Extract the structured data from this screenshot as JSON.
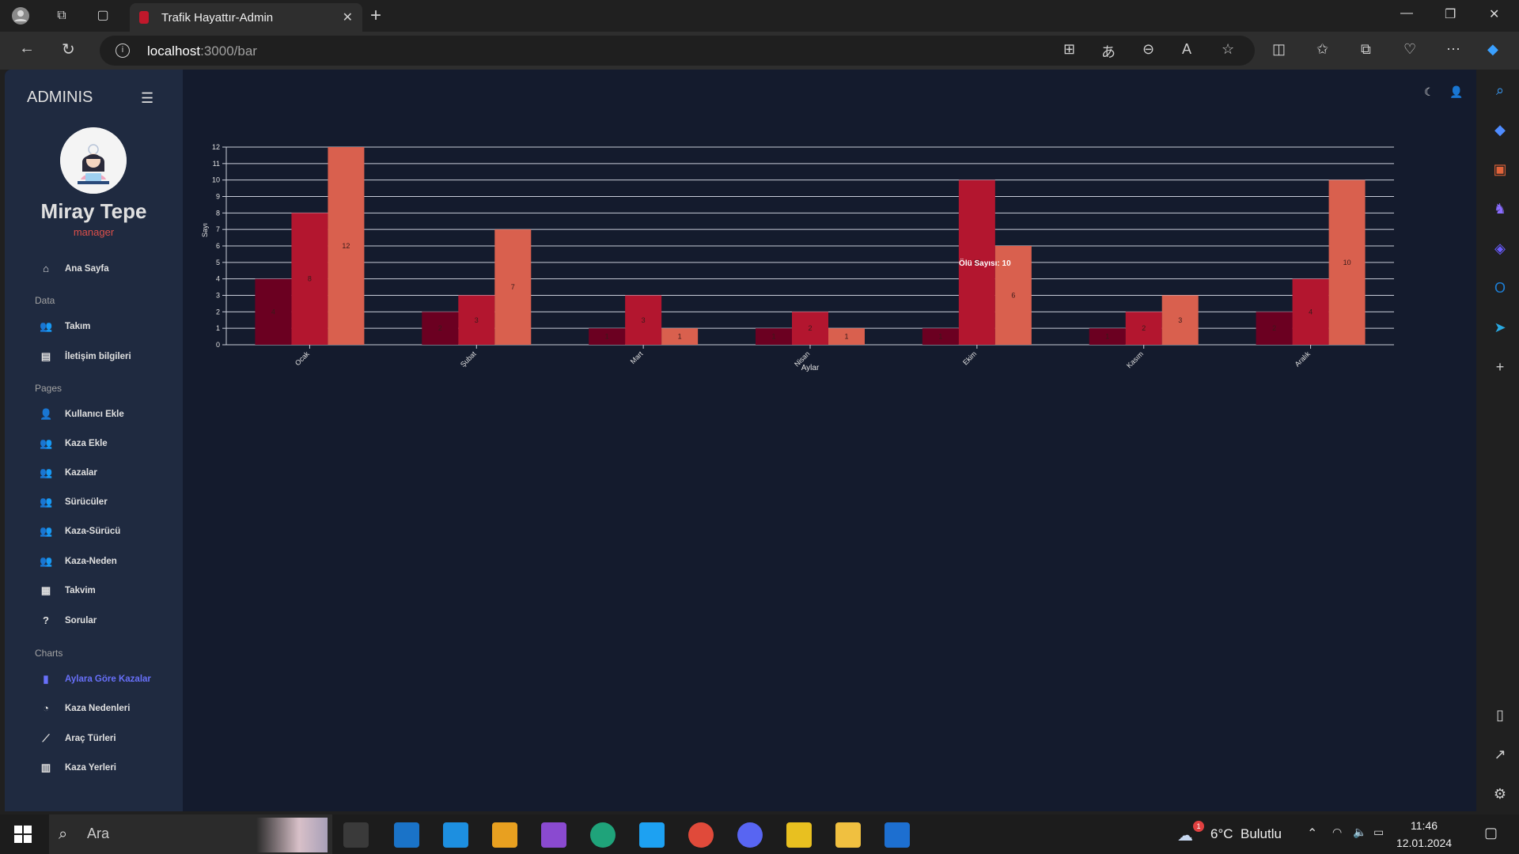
{
  "browser": {
    "tab_title": "Trafik Hayattır-Admin",
    "url_host": "localhost",
    "url_rest": ":3000/bar"
  },
  "sidebar": {
    "brand": "ADMINIS",
    "user_name": "Miray Tepe",
    "user_role": "manager",
    "home": {
      "label": "Ana Sayfa",
      "icon": "home-icon"
    },
    "sections": {
      "data": "Data",
      "pages": "Pages",
      "charts": "Charts"
    },
    "data_items": [
      {
        "label": "Takım",
        "icon": "team-icon"
      },
      {
        "label": "İletişim bilgileri",
        "icon": "contacts-icon"
      }
    ],
    "pages_items": [
      {
        "label": "Kullanıcı Ekle",
        "icon": "person-icon"
      },
      {
        "label": "Kaza Ekle",
        "icon": "group-add-icon"
      },
      {
        "label": "Kazalar",
        "icon": "group-add-icon"
      },
      {
        "label": "Sürücüler",
        "icon": "group-add-icon"
      },
      {
        "label": "Kaza-Sürücü",
        "icon": "group-add-icon"
      },
      {
        "label": "Kaza-Neden",
        "icon": "group-add-icon"
      },
      {
        "label": "Takvim",
        "icon": "calendar-icon"
      },
      {
        "label": "Sorular",
        "icon": "help-icon"
      }
    ],
    "charts_items": [
      {
        "label": "Aylara Göre Kazalar",
        "icon": "bar-chart-icon",
        "active": true
      },
      {
        "label": "Kaza Nedenleri",
        "icon": "pie-chart-icon"
      },
      {
        "label": "Araç Türleri",
        "icon": "line-chart-icon"
      },
      {
        "label": "Kaza Yerleri",
        "icon": "map-icon"
      }
    ]
  },
  "chart_data": {
    "type": "bar",
    "categories": [
      "Ocak",
      "Şubat",
      "Mart",
      "Nisan",
      "Ekim",
      "Kasım",
      "Aralık"
    ],
    "series": [
      {
        "values": [
          4,
          2,
          1,
          1,
          1,
          1,
          2
        ],
        "color": "#6b0021"
      },
      {
        "values": [
          8,
          3,
          3,
          2,
          10,
          2,
          4
        ],
        "color": "#b3162f"
      },
      {
        "values": [
          12,
          7,
          1,
          1,
          6,
          3,
          10
        ],
        "color": "#d9604e"
      }
    ],
    "xlabel": "Aylar",
    "ylabel": "Sayı",
    "ylim": [
      0,
      12
    ],
    "yticks": [
      0,
      1,
      2,
      3,
      4,
      5,
      6,
      7,
      8,
      9,
      10,
      11,
      12
    ],
    "grid": true,
    "tooltip": "Ölü Sayısı: 10"
  },
  "taskbar": {
    "search_placeholder": "Ara",
    "weather": "6°C  Bulutlu",
    "weather_badge": "1",
    "time": "11:46",
    "date": "12.01.2024"
  }
}
